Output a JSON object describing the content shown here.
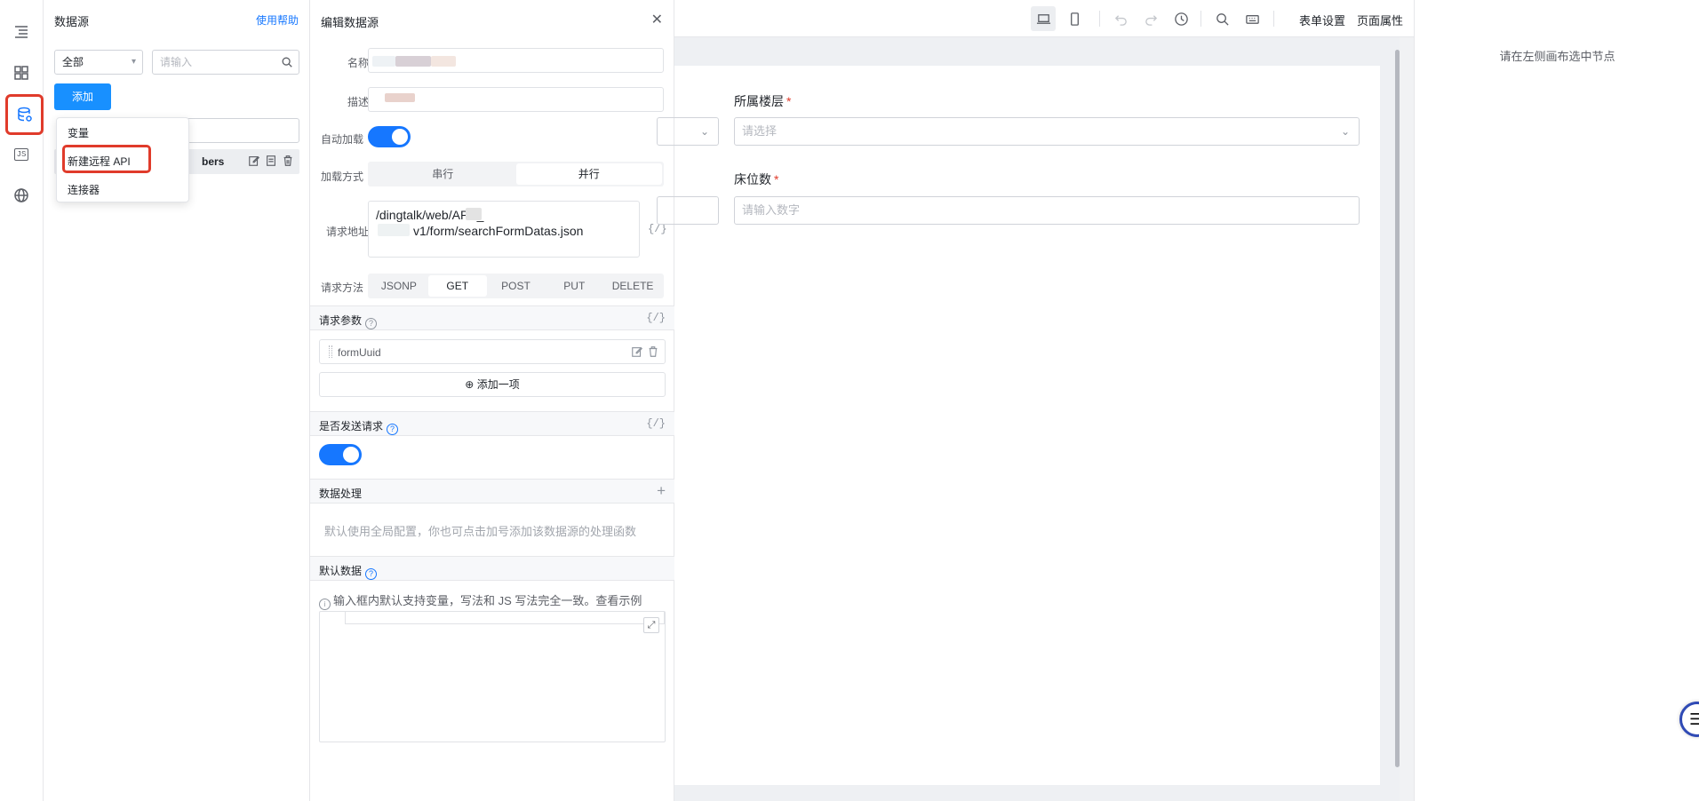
{
  "rail": {
    "icons": [
      "outline-icon",
      "components-icon",
      "datasource-icon",
      "js-icon",
      "globe-icon"
    ],
    "js_label": "JS",
    "active_color": "#1677ff",
    "highlight_color": "#e03b2b"
  },
  "datasource_panel": {
    "title": "数据源",
    "help_link": "使用帮助",
    "filter_select": "全部",
    "search_placeholder": "请输入",
    "add_button": "添加",
    "list_item_visible_text": "bers",
    "dropdown": {
      "items": [
        "变量",
        "新建远程 API",
        "连接器"
      ]
    }
  },
  "edit_drawer": {
    "title": "编辑数据源",
    "name_label": "名称",
    "description_label": "描述",
    "autoload_label": "自动加载",
    "autoload_on": true,
    "load_mode_label": "加载方式",
    "load_mode_options": [
      "串行",
      "并行"
    ],
    "load_mode_selected": "并行",
    "url_label": "请求地址",
    "url_line1": "/dingtalk/web/APP_",
    "url_line2": "v1/form/searchFormDatas.json",
    "code_icon": "{/}",
    "method_label": "请求方法",
    "methods": [
      "JSONP",
      "GET",
      "POST",
      "PUT",
      "DELETE"
    ],
    "method_selected": "GET",
    "params_title": "请求参数",
    "param_name": "formUuid",
    "add_item": "添加一项",
    "send_request_title": "是否发送请求",
    "send_request_on": true,
    "data_processing_title": "数据处理",
    "data_processing_hint": "默认使用全局配置，你也可点击加号添加该数据源的处理函数",
    "default_data_title": "默认数据",
    "default_data_hint": "输入框内默认支持变量，写法和 JS 写法完全一致。查看示例"
  },
  "toolbar": {
    "form_settings": "表单设置",
    "page_properties": "页面属性"
  },
  "form": {
    "floor_label": "所属楼层",
    "floor_placeholder": "请选择",
    "beds_label": "床位数",
    "beds_placeholder": "请输入数字",
    "required_mark": "*"
  },
  "right_panel": {
    "hint": "请在左侧画布选中节点"
  }
}
